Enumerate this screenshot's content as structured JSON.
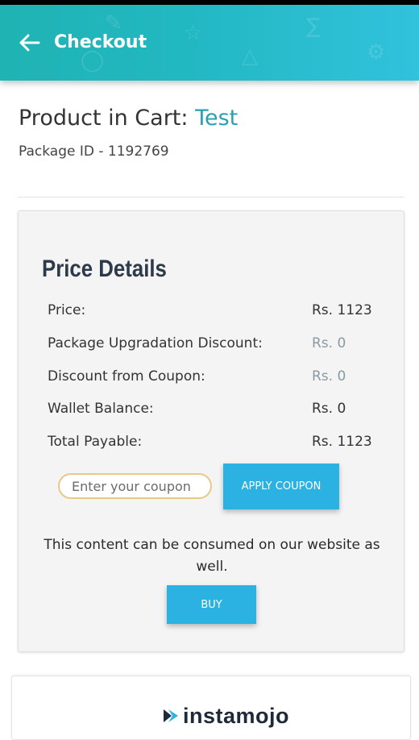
{
  "header": {
    "title": "Checkout",
    "back_icon": "arrow-left-icon"
  },
  "product": {
    "prefix": "Product in Cart: ",
    "name": "Test",
    "package_id": "Package ID - 1192769"
  },
  "price_details": {
    "title": "Price Details",
    "rows": [
      {
        "label": "Price:",
        "value": "Rs. 1123"
      },
      {
        "label": "Package Upgradation Discount:",
        "value": "Rs. 0"
      },
      {
        "label": "Discount from Coupon:",
        "value": "Rs. 0"
      },
      {
        "label": "Wallet Balance:",
        "value": "Rs. 0"
      },
      {
        "label": "Total Payable:",
        "value": "Rs. 1123"
      }
    ]
  },
  "coupon": {
    "placeholder": "Enter your coupon",
    "apply_label": "APPLY COUPON"
  },
  "note": "This content can be consumed on our website as well.",
  "buy_label": "BUY",
  "payment": {
    "logo_text": "instamojo",
    "logo_icon": "instamojo-logo-icon"
  },
  "colors": {
    "header": "#22b8c2",
    "accent": "#2a9fb0",
    "button": "#2bb2e3",
    "muted_value": "#8a9aa3"
  }
}
